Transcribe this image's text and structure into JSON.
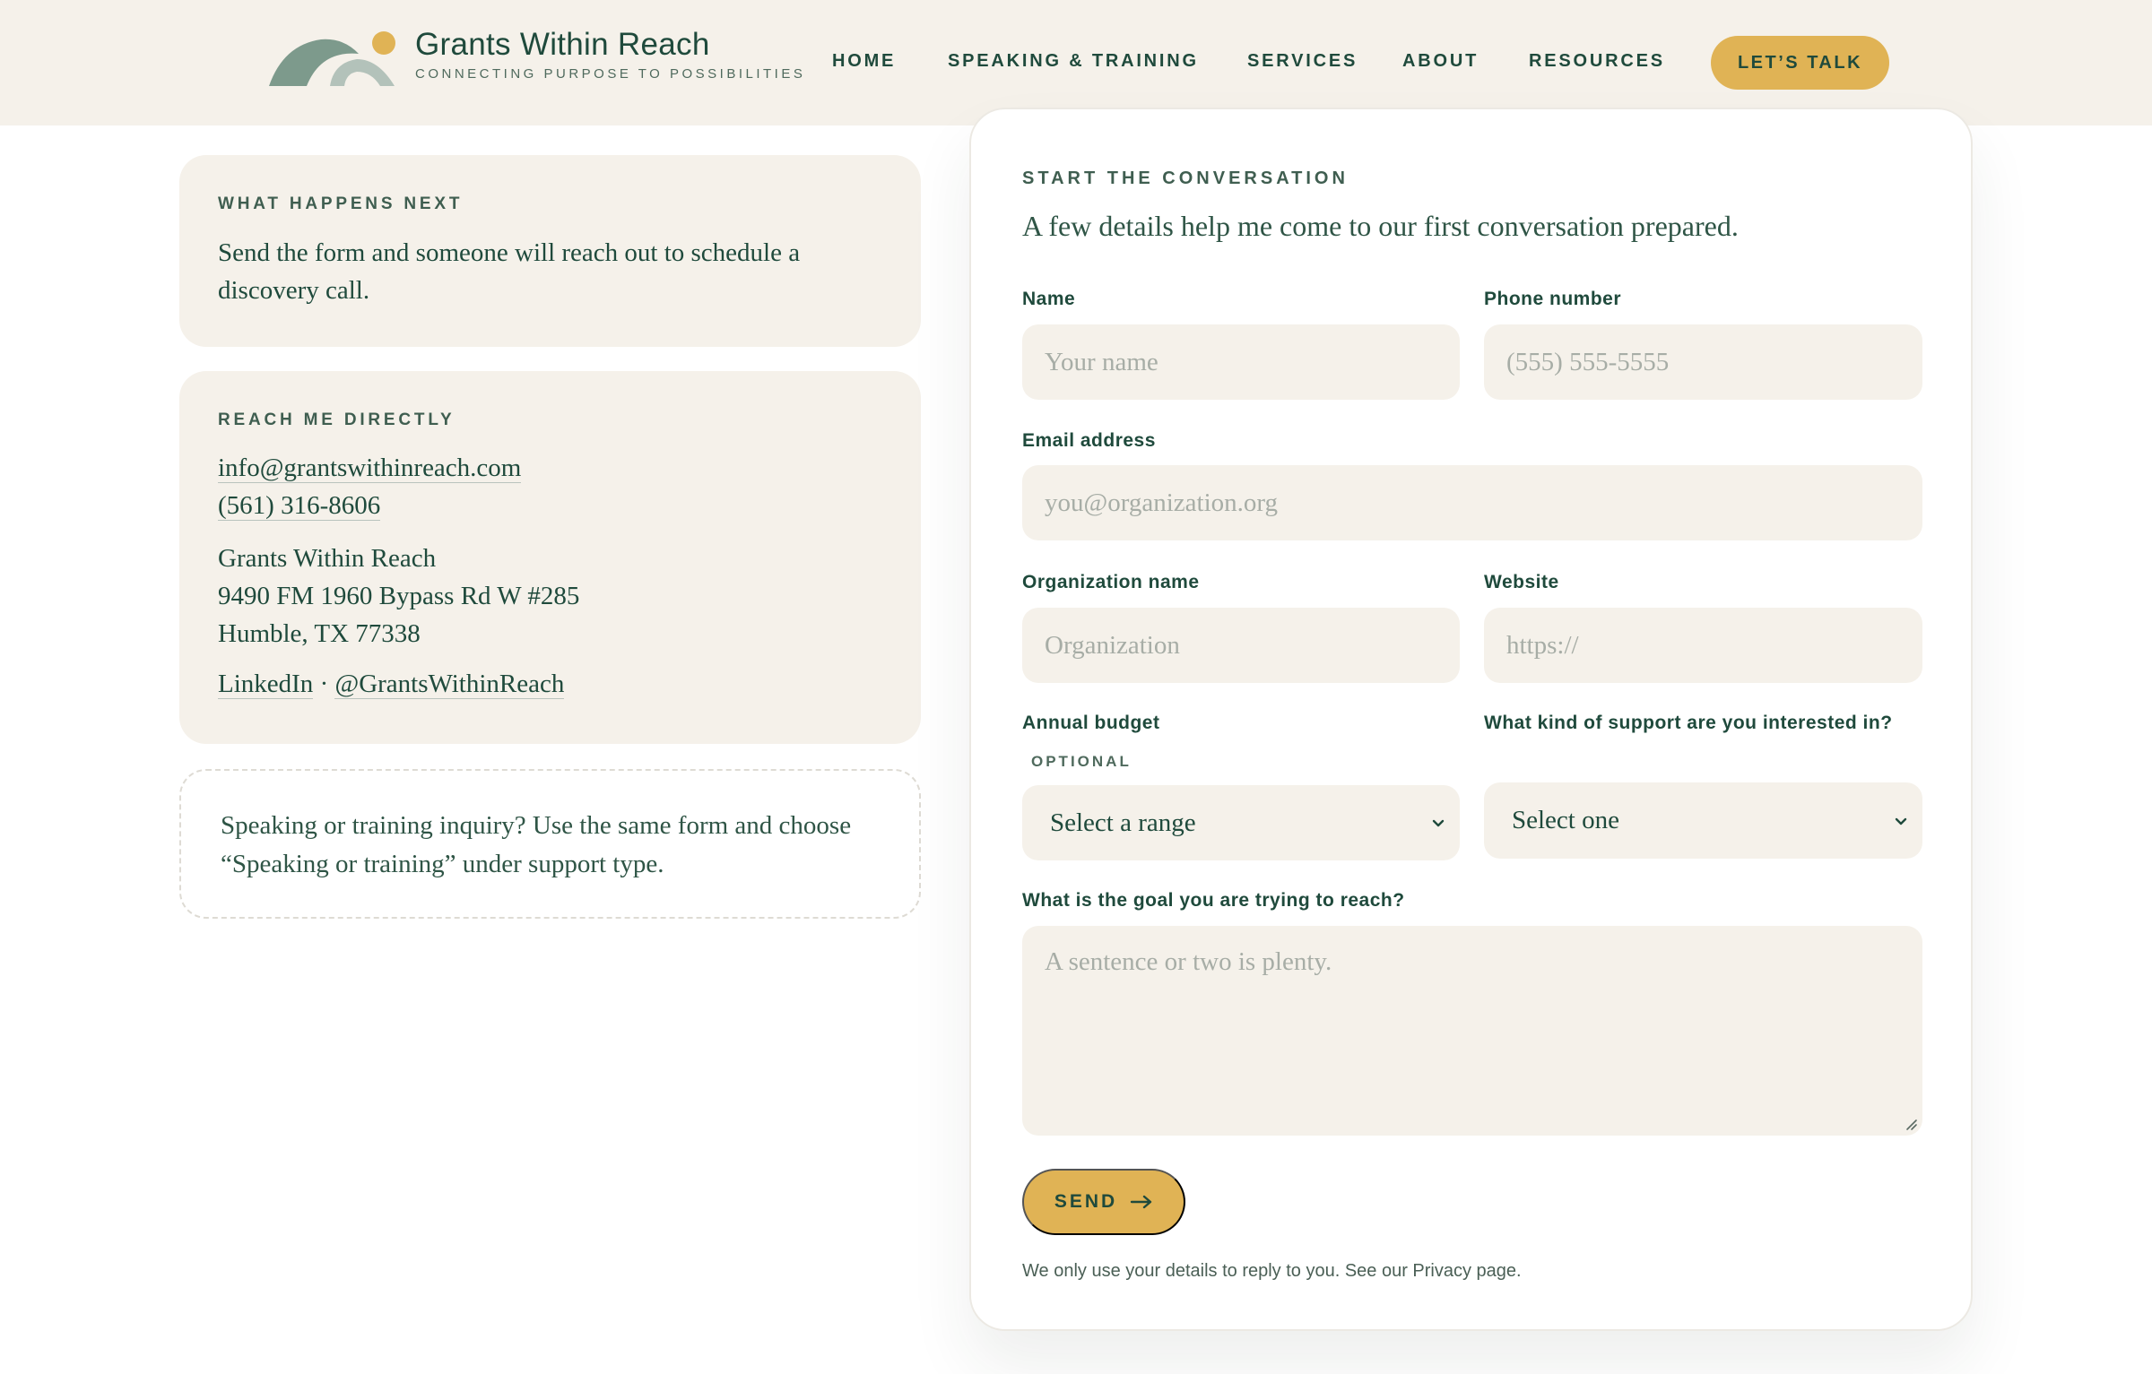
{
  "brand": {
    "name": "Grants Within Reach",
    "tagline": "CONNECTING PURPOSE TO POSSIBILITIES",
    "colors": {
      "primary": "#1f4a3c",
      "accent": "#e0b355",
      "cream": "#f5f1ea",
      "sage": "#7d9a8c"
    }
  },
  "nav": {
    "items": [
      {
        "label": "HOME"
      },
      {
        "label": "SPEAKING & TRAINING"
      },
      {
        "label": "SERVICES"
      },
      {
        "label": "ABOUT"
      },
      {
        "label": "RESOURCES"
      }
    ],
    "cta_label": "LET’S TALK"
  },
  "sidebar": {
    "next": {
      "heading": "WHAT HAPPENS NEXT",
      "text_line1": "Send the form and someone will reach out to schedule a",
      "text_line2": "discovery call."
    },
    "reach": {
      "heading": "REACH ME DIRECTLY",
      "email": "info@grantswithinreach.com",
      "phone": "(561) 316-8606",
      "address_name": "Grants Within Reach",
      "address_street": "9490 FM 1960 Bypass Rd W #285",
      "address_city": "Humble, TX 77338",
      "linkedin_label": "LinkedIn",
      "separator": " · ",
      "linkedin_handle": "@GrantsWithinReach"
    },
    "note": {
      "text": "Speaking or training inquiry? Use the same form and choose “Speaking or training” under support type."
    }
  },
  "form": {
    "eyebrow": "START THE CONVERSATION",
    "intro": "A few details help me come to our first conversation prepared.",
    "name": {
      "label": "Name",
      "placeholder": "Your name",
      "value": ""
    },
    "phone": {
      "label": "Phone number",
      "placeholder": "(555) 555-5555",
      "value": ""
    },
    "email": {
      "label": "Email address",
      "placeholder": "you@organization.org",
      "value": ""
    },
    "organization": {
      "label": "Organization name",
      "placeholder": "Organization",
      "value": ""
    },
    "website": {
      "label": "Website",
      "placeholder": "https://",
      "value": ""
    },
    "budget": {
      "label": "Annual budget",
      "optional_label": "OPTIONAL",
      "selected": "Select a range"
    },
    "support": {
      "label": "What kind of support are you interested in?",
      "selected": "Select one"
    },
    "goal": {
      "label": "What is the goal you are trying to reach?",
      "placeholder": "A sentence or two is plenty.",
      "value": ""
    },
    "submit_label": "SEND",
    "submit_icon": "arrow-right-icon",
    "privacy_note": "We only use your details to reply to you. See our Privacy page."
  }
}
